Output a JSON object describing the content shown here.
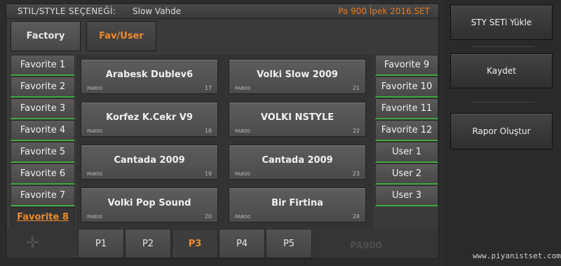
{
  "title_bar": {
    "label": "STIL/STYLE SEÇENEĞİ:",
    "style_name": "Slow Vahde",
    "set_file": "Pa 900 İpek 2016.SET"
  },
  "tabs": [
    {
      "label": "Factory",
      "active": false
    },
    {
      "label": "Fav/User",
      "active": true
    }
  ],
  "left_items": [
    {
      "label": "Favorite 1"
    },
    {
      "label": "Favorite 2"
    },
    {
      "label": "Favorite 3"
    },
    {
      "label": "Favorite 4"
    },
    {
      "label": "Favorite 5"
    },
    {
      "label": "Favorite 6"
    },
    {
      "label": "Favorite 7"
    },
    {
      "label": "Favorite 8",
      "active": true
    }
  ],
  "right_items": [
    {
      "label": "Favorite 9"
    },
    {
      "label": "Favorite 10"
    },
    {
      "label": "Favorite 11"
    },
    {
      "label": "Favorite 12"
    },
    {
      "label": "User 1"
    },
    {
      "label": "User 2"
    },
    {
      "label": "User 3"
    }
  ],
  "styles": [
    {
      "name": "Arabesk Dublev6",
      "device": "PA800",
      "number": "17"
    },
    {
      "name": "Volki Slow 2009",
      "device": "PA800",
      "number": "21"
    },
    {
      "name": "Korfez K.Cekr V9",
      "device": "PA800",
      "number": "18"
    },
    {
      "name": "VOLKI NSTYLE",
      "device": "PA800",
      "number": "22"
    },
    {
      "name": "Cantada 2009",
      "device": "PA800",
      "number": "19"
    },
    {
      "name": "Cantada 2009",
      "device": "PA800",
      "number": "23"
    },
    {
      "name": "Volki Pop Sound",
      "device": "PA800",
      "number": "20"
    },
    {
      "name": "Bir Firtina",
      "device": "PA800",
      "number": "24"
    }
  ],
  "pages": [
    {
      "label": "P1"
    },
    {
      "label": "P2"
    },
    {
      "label": "P3",
      "active": true
    },
    {
      "label": "P4"
    },
    {
      "label": "P5"
    }
  ],
  "bottom_brand": "PA900",
  "actions": {
    "load_set": "STY SETi Yükle",
    "save": "Kaydet",
    "report": "Rapor Oluştur"
  },
  "watermark": "www.piyanistset.com",
  "colors": {
    "accent": "#f08a2a",
    "indicator": "#3fa63f"
  }
}
